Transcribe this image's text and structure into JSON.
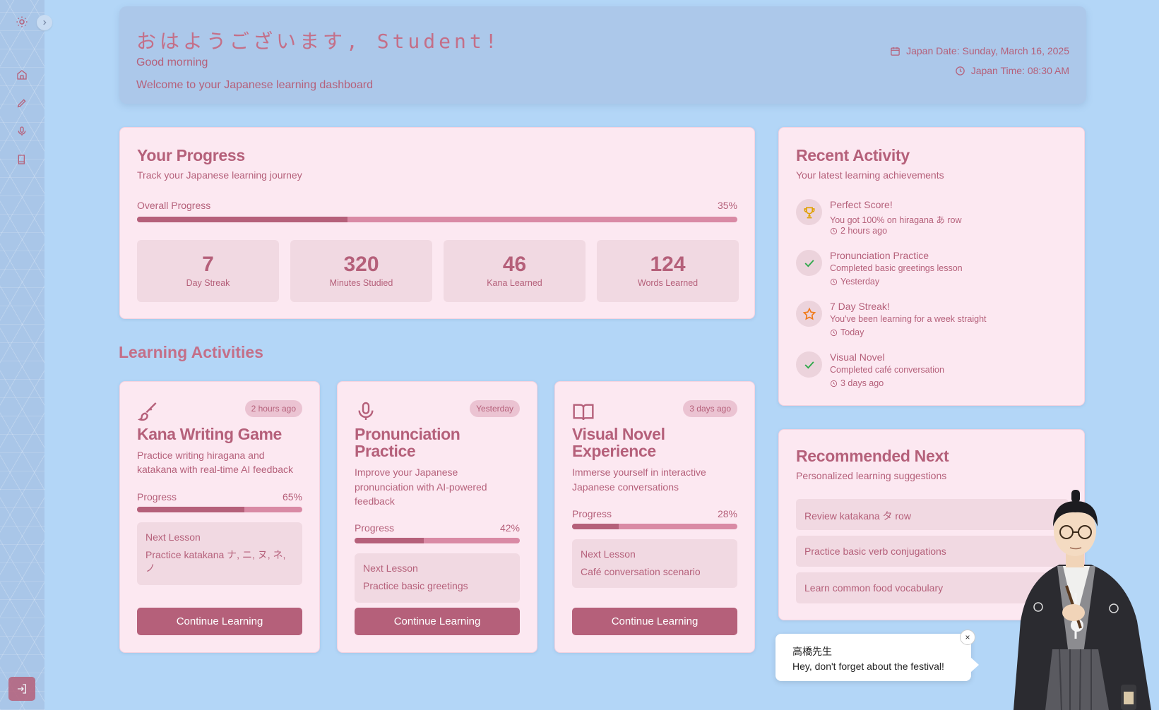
{
  "header": {
    "greeting_jp": "おはようございます, Student!",
    "greeting_en": "Good morning",
    "welcome": "Welcome to your Japanese learning dashboard",
    "date": "Japan Date: Sunday, March 16, 2025",
    "time": "Japan Time: 08:30 AM"
  },
  "progress": {
    "title": "Your Progress",
    "subtitle": "Track your Japanese learning journey",
    "overall_label": "Overall Progress",
    "overall_value": "35%",
    "overall_fraction": 0.35,
    "stats": [
      {
        "value": "7",
        "label": "Day Streak"
      },
      {
        "value": "320",
        "label": "Minutes Studied"
      },
      {
        "value": "46",
        "label": "Kana Learned"
      },
      {
        "value": "124",
        "label": "Words Learned"
      }
    ]
  },
  "activities": {
    "title": "Learning Activities",
    "progress_label": "Progress",
    "next_label": "Next Lesson",
    "button_label": "Continue Learning",
    "items": [
      {
        "title": "Kana Writing Game",
        "badge": "2 hours ago",
        "desc": "Practice writing hiragana and katakana with real-time AI feedback",
        "progress": "65%",
        "fraction": 0.65,
        "next": "Practice katakana ナ, ニ, ヌ, ネ, ノ",
        "icon": "brush-icon"
      },
      {
        "title": "Pronunciation Practice",
        "badge": "Yesterday",
        "desc": "Improve your Japanese pronunciation with AI-powered feedback",
        "progress": "42%",
        "fraction": 0.42,
        "next": "Practice basic greetings",
        "icon": "microphone-icon"
      },
      {
        "title": "Visual Novel Experience",
        "badge": "3 days ago",
        "desc": "Immerse yourself in interactive Japanese conversations",
        "progress": "28%",
        "fraction": 0.28,
        "next": "Café conversation scenario",
        "icon": "book-icon"
      }
    ]
  },
  "recent": {
    "title": "Recent Activity",
    "subtitle": "Your latest learning achievements",
    "items": [
      {
        "title": "Perfect Score!",
        "desc": "You got 100% on hiragana あ row",
        "time": "2 hours ago",
        "icon": "trophy-icon"
      },
      {
        "title": "Pronunciation Practice",
        "desc": "Completed basic greetings lesson",
        "time": "Yesterday",
        "icon": "check-icon"
      },
      {
        "title": "7 Day Streak!",
        "desc": "You've been learning for a week straight",
        "time": "Today",
        "icon": "star-icon"
      },
      {
        "title": "Visual Novel",
        "desc": "Completed café conversation",
        "time": "3 days ago",
        "icon": "check-icon"
      }
    ]
  },
  "recommended": {
    "title": "Recommended Next",
    "subtitle": "Personalized learning suggestions",
    "items": [
      "Review katakana タ row",
      "Practice basic verb conjugations",
      "Learn common food vocabulary"
    ]
  },
  "bubble": {
    "name": "高橋先生",
    "text": "Hey, don't forget about the festival!",
    "close": "×"
  },
  "colors": {
    "accent": "#b5607a",
    "background": "#b3d6f7",
    "card": "#fce8f1"
  }
}
